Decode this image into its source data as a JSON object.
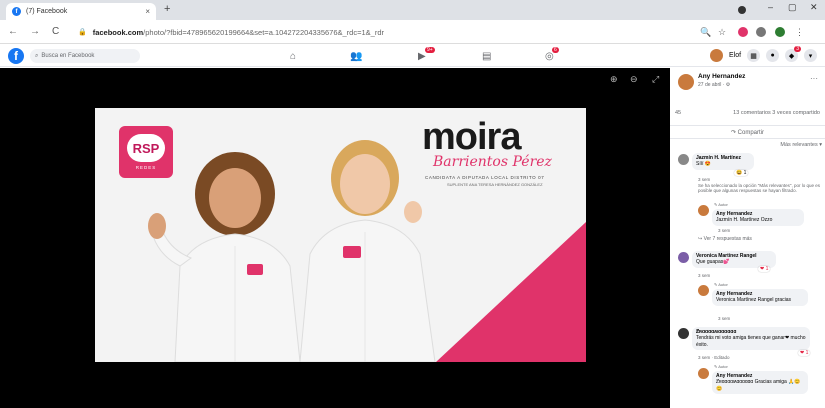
{
  "browser": {
    "tab_title": "(7) Facebook",
    "tab_close": "×",
    "new_tab": "+",
    "win_min": "–",
    "win_max": "▢",
    "win_close": "✕",
    "nav_back": "←",
    "nav_forward": "→",
    "nav_reload": "C",
    "url_host": "facebook.com",
    "url_path": "/photo/?fbid=478965620199664&set=a.104272204335676&_rdc=1&_rdr",
    "lock_icon": "🔒"
  },
  "fb": {
    "search_placeholder": "Busca en Facebook",
    "badges": {
      "watch": "9+",
      "groups": "6"
    },
    "profile_name": "Elof",
    "notif_badge": "3"
  },
  "viewer": {
    "zoom_in": "⊕",
    "zoom_out": "⊖",
    "fullscreen": "⤢"
  },
  "photo": {
    "logo_text": "RSP",
    "logo_sub": "REDES",
    "title": "moira",
    "surname": "Barrientos Pérez",
    "candidate_line": "CANDIDATA A DIPUTADA LOCAL DISTRITO 07",
    "suplente_line": "SUPLENTE ANA TERESA HERNÁNDEZ GONZÁLEZ"
  },
  "post": {
    "author": "Any Hernandez",
    "date": "27 de abril · ⚙",
    "more": "···",
    "reactions_count": "45",
    "comments_shares": "13 comentarios  3 veces compartido",
    "share_label": "↷ Compartir",
    "sort_label": "Más relevantes ▾"
  },
  "comments": [
    {
      "name": "Jazmín H. Martínez",
      "text": "Sííí 😍",
      "meta": "3 sem",
      "react": "😆 1"
    },
    {
      "note": "Se ha seleccionado la opción \"Más relevantes\", por lo que es posible que algunas respuestas se hayan filtrado."
    },
    {
      "author_tag": "✎ Autor",
      "name": "Any Hernandez",
      "text": "Jazmín H. Martínez Ozzo",
      "meta": "3 sem"
    },
    {
      "replies": "↪ Ver 7 respuestas más"
    },
    {
      "name": "Veronica Martínez Rangel",
      "text": "Que guapas💕",
      "meta": "3 sem",
      "react": "❤ 1"
    },
    {
      "author_tag": "✎ Autor",
      "name": "Any Hernandez",
      "text": "Veronica Martínez Rangel gracias",
      "meta": "3 sem"
    },
    {
      "name": "Ƶʀɑɑɑɑʍɑɑɑɑɑɑ",
      "text": "Tendrás mi voto amiga tienes que ganar❤ mucho éxito.",
      "meta": "3 sem · Editado",
      "react": "❤ 1"
    },
    {
      "author_tag": "✎ Autor",
      "name": "Any Hernandez",
      "text": "Ƶʀɑɑɑɑʍɑɑɑɑɑɑ Gracias amiga 🙏😊😊",
      "meta": ""
    }
  ]
}
